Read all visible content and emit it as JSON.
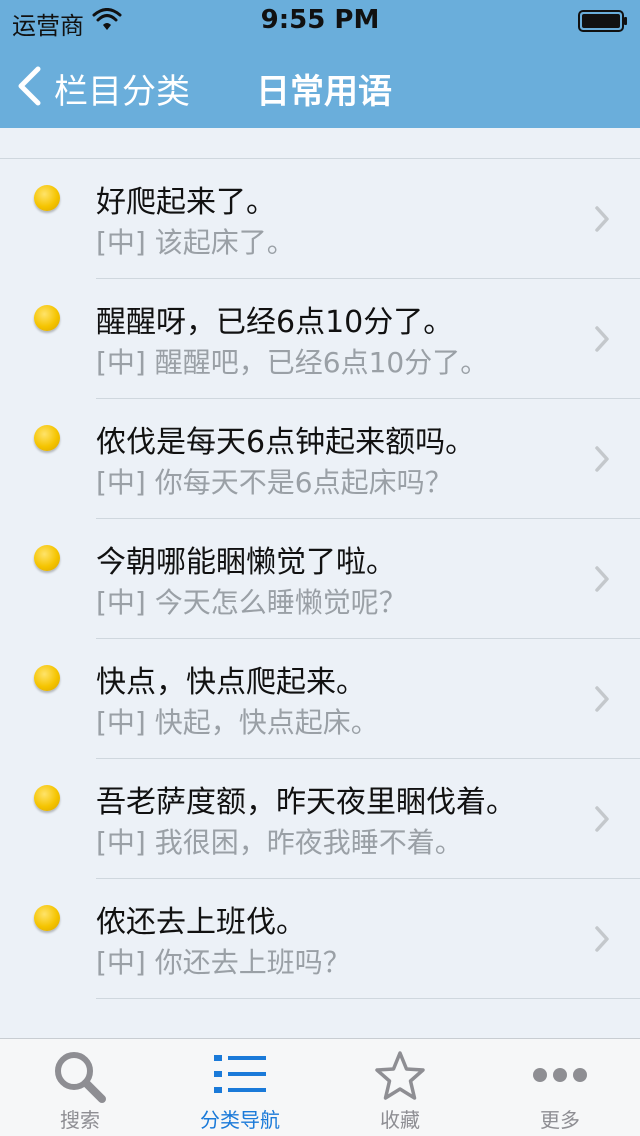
{
  "status": {
    "carrier": "运营商",
    "time": "9:55 PM"
  },
  "nav": {
    "back_label": "栏目分类",
    "title": "日常用语"
  },
  "items": [
    {
      "primary": "好爬起来了。",
      "secondary": "[中] 该起床了。"
    },
    {
      "primary": "醒醒呀，已经6点10分了。",
      "secondary": "[中] 醒醒吧，已经6点10分了。"
    },
    {
      "primary": "侬伐是每天6点钟起来额吗。",
      "secondary": "[中] 你每天不是6点起床吗？"
    },
    {
      "primary": "今朝哪能睏懒觉了啦。",
      "secondary": "[中] 今天怎么睡懒觉呢？"
    },
    {
      "primary": "快点，快点爬起来。",
      "secondary": "[中] 快起，快点起床。"
    },
    {
      "primary": "吾老萨度额，昨天夜里睏伐着。",
      "secondary": "[中] 我很困，昨夜我睡不着。"
    },
    {
      "primary": "侬还去上班伐。",
      "secondary": "[中] 你还去上班吗？"
    }
  ],
  "tabs": [
    {
      "label": "搜索",
      "icon": "search-icon"
    },
    {
      "label": "分类导航",
      "icon": "list-icon",
      "active": true
    },
    {
      "label": "收藏",
      "icon": "star-icon"
    },
    {
      "label": "更多",
      "icon": "more-icon"
    }
  ],
  "colors": {
    "nav_bg": "#6aaedb",
    "accent": "#1a7ad9",
    "bullet": "#f5c400"
  }
}
